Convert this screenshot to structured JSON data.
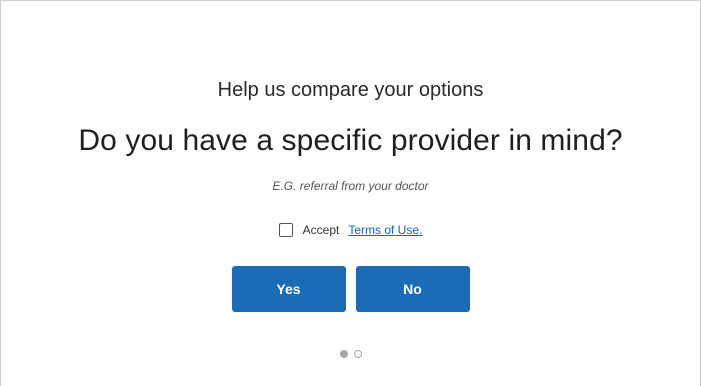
{
  "header": {
    "subtitle": "Help us compare your options",
    "question": "Do you have a specific provider in mind?",
    "hint": "E.G. referral from your doctor"
  },
  "terms": {
    "checked": false,
    "accept_label": "Accept",
    "link_label": "Terms of Use."
  },
  "actions": {
    "yes_label": "Yes",
    "no_label": "No"
  },
  "pagination": {
    "total_steps": 2,
    "current_step": 1
  },
  "colors": {
    "button_primary": "#1a6bb8",
    "link": "#0a66c2",
    "dot": "#a6a6a6"
  }
}
